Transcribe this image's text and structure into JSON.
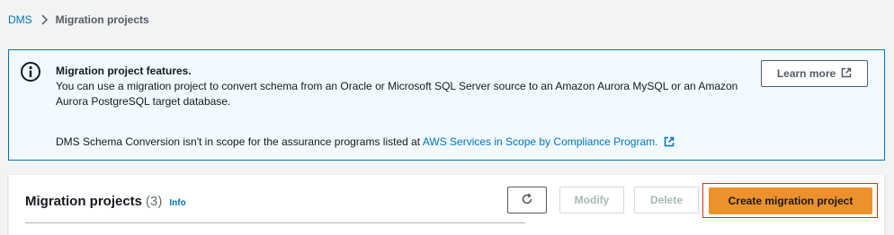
{
  "breadcrumb": {
    "root": "DMS",
    "current": "Migration projects"
  },
  "info": {
    "title": "Migration project features.",
    "body": "You can use a migration project to convert schema from an Oracle or Microsoft SQL Server source to an Amazon Aurora MySQL or an Amazon Aurora PostgreSQL target database.",
    "scope_prefix": "DMS Schema Conversion isn't in scope for the assurance programs listed at ",
    "scope_link": "AWS Services in Scope by Compliance Program.",
    "learn_more": "Learn more"
  },
  "projects": {
    "title": "Migration projects",
    "count": "(3)",
    "info_link": "Info",
    "modify": "Modify",
    "delete": "Delete",
    "create": "Create migration project"
  },
  "colors": {
    "link": "#0073bb",
    "primary": "#ec912d",
    "highlight": "#d13212",
    "info_bg": "#f1faff"
  }
}
